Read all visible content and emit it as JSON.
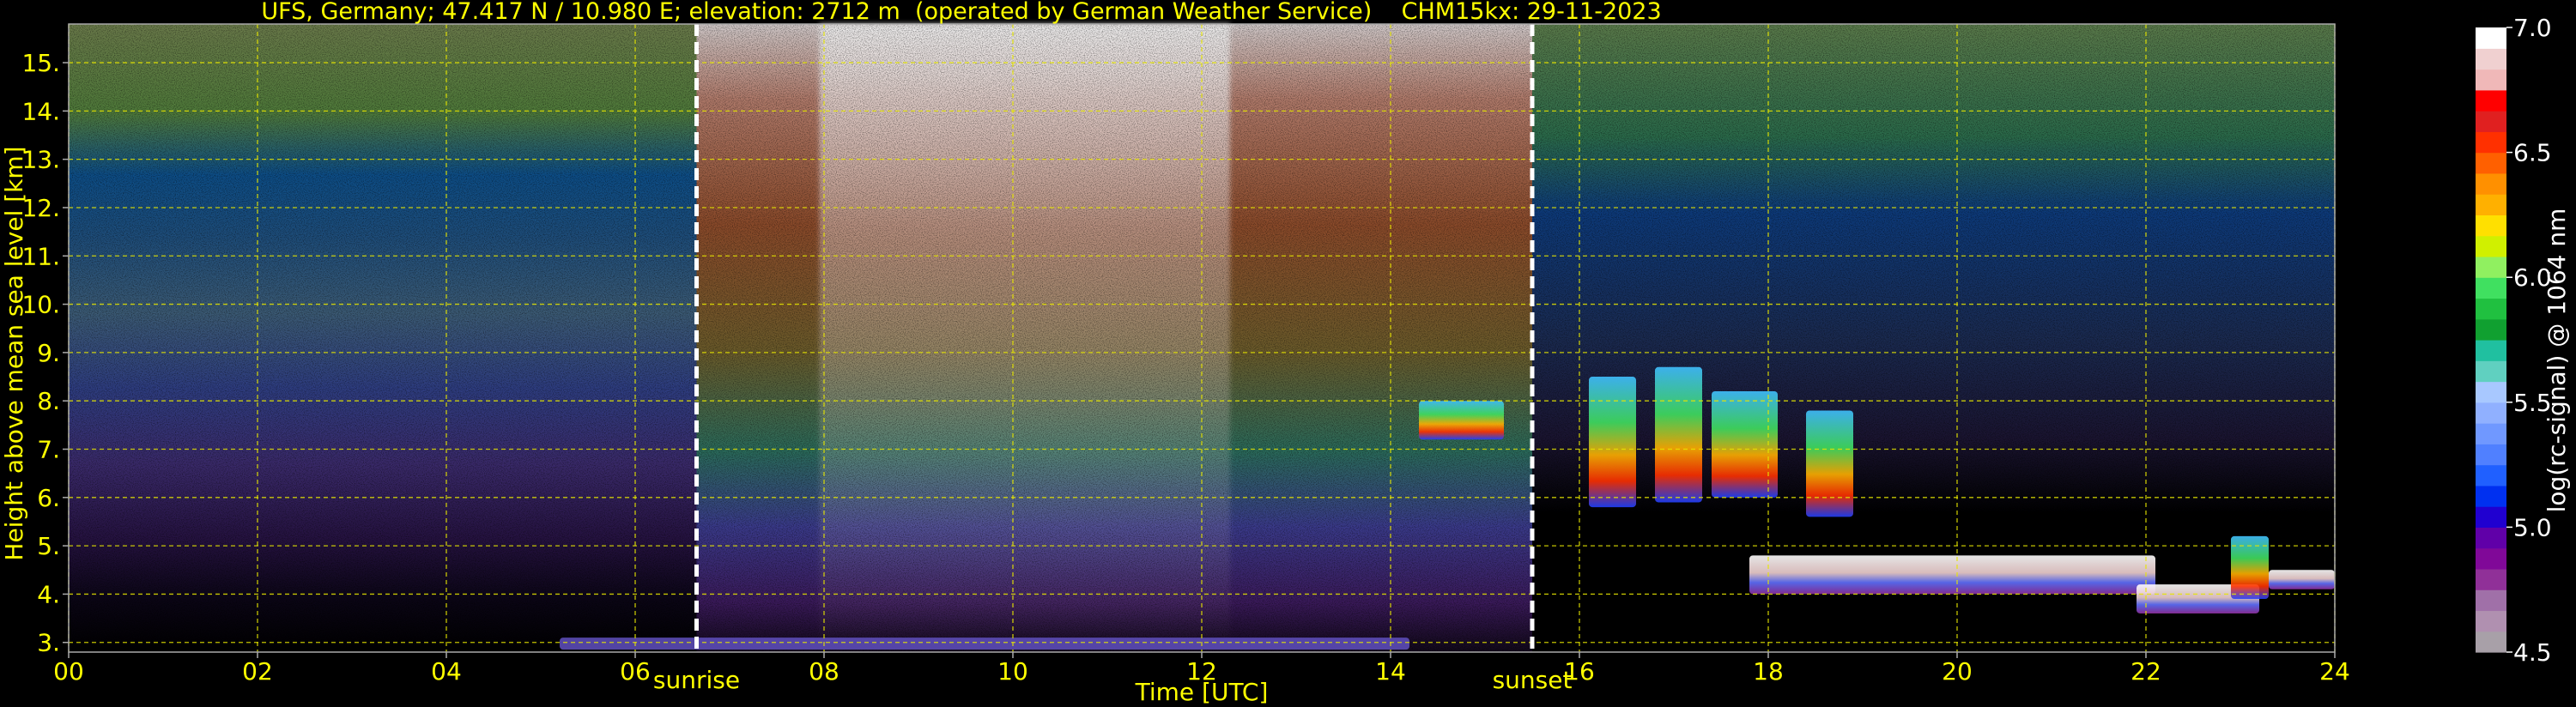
{
  "chart_data": {
    "type": "heatmap",
    "title": "UFS, Germany; 47.417 N / 10.980 E; elevation: 2712 m  (operated by German Weather Service)    CHM15kx: 29-11-2023",
    "xlabel": "Time [UTC]",
    "ylabel": "Height above mean sea level [km]",
    "xlim": [
      0,
      24
    ],
    "ylim": [
      2.8,
      15.8
    ],
    "x_ticks": [
      "00",
      "02",
      "04",
      "06",
      "08",
      "10",
      "12",
      "14",
      "16",
      "18",
      "20",
      "22",
      "24"
    ],
    "y_ticks": [
      "3.",
      "4.",
      "5.",
      "6.",
      "7.",
      "8.",
      "9.",
      "10.",
      "11.",
      "12.",
      "13.",
      "14.",
      "15."
    ],
    "grid": true,
    "markers": [
      {
        "label": "sunrise",
        "x": 6.65
      },
      {
        "label": "sunset",
        "x": 15.5
      }
    ],
    "colorbar": {
      "label": "log(rc-signal) @ 1064 nm",
      "range": [
        4.5,
        7.0
      ],
      "ticks": [
        "4.5",
        "5.0",
        "5.5",
        "6.0",
        "6.5",
        "7.0"
      ],
      "colors": [
        "#a8a0a8",
        "#b090b0",
        "#a070a8",
        "#903098",
        "#800898",
        "#6000a8",
        "#2000d0",
        "#0030f0",
        "#2060ff",
        "#5080ff",
        "#7098ff",
        "#90b0ff",
        "#a8c8ff",
        "#60d0c0",
        "#20c0a0",
        "#10a030",
        "#20c040",
        "#40e060",
        "#90f060",
        "#d0f000",
        "#ffe000",
        "#ffb000",
        "#ff9000",
        "#ff6000",
        "#ff3000",
        "#e02020",
        "#ff0000",
        "#f0b8b8",
        "#f0d0d0",
        "#ffffff"
      ]
    },
    "features": [
      {
        "name": "ground_layer",
        "x_start": 5.2,
        "x_end": 14.2,
        "y_bottom": 2.85,
        "y_top": 3.1
      },
      {
        "name": "cloud_patch_a",
        "x_start": 14.3,
        "x_end": 15.2,
        "y_bottom": 7.2,
        "y_top": 8.0
      },
      {
        "name": "cloud_column_a",
        "x_start": 16.1,
        "x_end": 16.6,
        "y_bottom": 5.8,
        "y_top": 8.5
      },
      {
        "name": "cloud_column_b",
        "x_start": 16.8,
        "x_end": 17.3,
        "y_bottom": 5.9,
        "y_top": 8.7
      },
      {
        "name": "cloud_column_c",
        "x_start": 17.4,
        "x_end": 18.1,
        "y_bottom": 6.0,
        "y_top": 8.2
      },
      {
        "name": "cloud_column_d",
        "x_start": 18.4,
        "x_end": 18.9,
        "y_bottom": 5.6,
        "y_top": 7.8
      },
      {
        "name": "low_cloud_band",
        "x_start": 17.8,
        "x_end": 22.1,
        "y_bottom": 4.0,
        "y_top": 4.8
      },
      {
        "name": "low_cloud_tail",
        "x_start": 21.9,
        "x_end": 23.2,
        "y_bottom": 3.6,
        "y_top": 4.2
      },
      {
        "name": "cloud_patch_b",
        "x_start": 22.9,
        "x_end": 23.3,
        "y_bottom": 3.9,
        "y_top": 5.2
      },
      {
        "name": "cloud_patch_c",
        "x_start": 23.3,
        "x_end": 24.0,
        "y_bottom": 4.1,
        "y_top": 4.5
      }
    ]
  }
}
